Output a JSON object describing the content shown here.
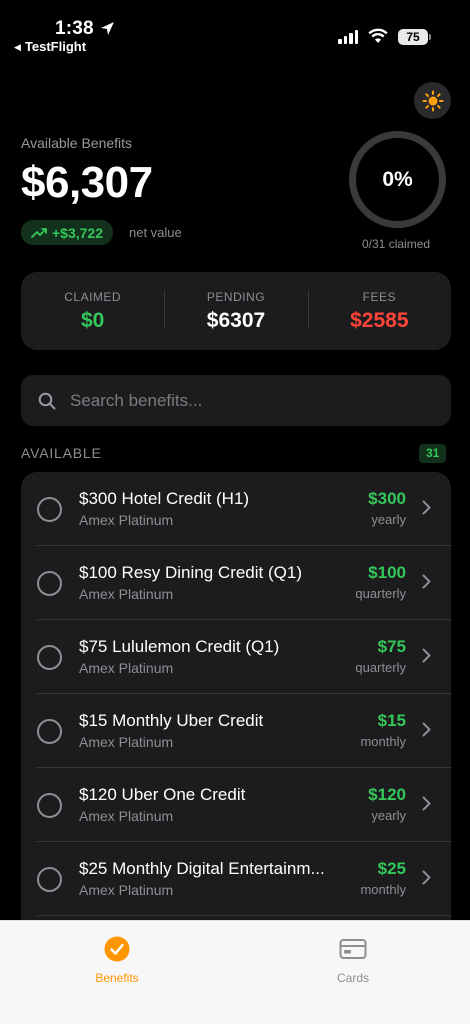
{
  "status_bar": {
    "time": "1:38",
    "back_app": "TestFlight",
    "battery": "75"
  },
  "header": {
    "available_label": "Available Benefits",
    "available_amount": "$6,307",
    "net_value": "+$3,722",
    "net_label": "net value",
    "progress_percent_label": "0%",
    "progress_fraction": 0,
    "claimed_caption": "0/31 claimed"
  },
  "summary": {
    "claimed_label": "CLAIMED",
    "claimed_value": "$0",
    "pending_label": "PENDING",
    "pending_value": "$6307",
    "fees_label": "FEES",
    "fees_value": "$2585"
  },
  "search": {
    "placeholder": "Search benefits..."
  },
  "section": {
    "title": "AVAILABLE",
    "count": "31"
  },
  "benefits": [
    {
      "title": "$300 Hotel Credit (H1)",
      "card": "Amex Platinum",
      "amount": "$300",
      "period": "yearly"
    },
    {
      "title": "$100 Resy Dining Credit (Q1)",
      "card": "Amex Platinum",
      "amount": "$100",
      "period": "quarterly"
    },
    {
      "title": "$75 Lululemon Credit (Q1)",
      "card": "Amex Platinum",
      "amount": "$75",
      "period": "quarterly"
    },
    {
      "title": "$15 Monthly Uber Credit",
      "card": "Amex Platinum",
      "amount": "$15",
      "period": "monthly"
    },
    {
      "title": "$120 Uber One Credit",
      "card": "Amex Platinum",
      "amount": "$120",
      "period": "yearly"
    },
    {
      "title": "$25 Monthly Digital Entertainm...",
      "card": "Amex Platinum",
      "amount": "$25",
      "period": "monthly"
    }
  ],
  "tabbar": {
    "benefits_label": "Benefits",
    "cards_label": "Cards",
    "active_color": "#ff9500",
    "inactive_color": "#8e8e93"
  },
  "colors": {
    "accent_green": "#34c759",
    "fees_red": "#ff453a",
    "sun_orange": "#ff9f0a"
  },
  "icons": [
    "location-arrow-icon",
    "signal-icon",
    "wifi-icon",
    "sun-icon",
    "trend-up-icon",
    "search-icon",
    "chevron-right-icon",
    "checkmark-circle-icon",
    "credit-card-icon"
  ]
}
